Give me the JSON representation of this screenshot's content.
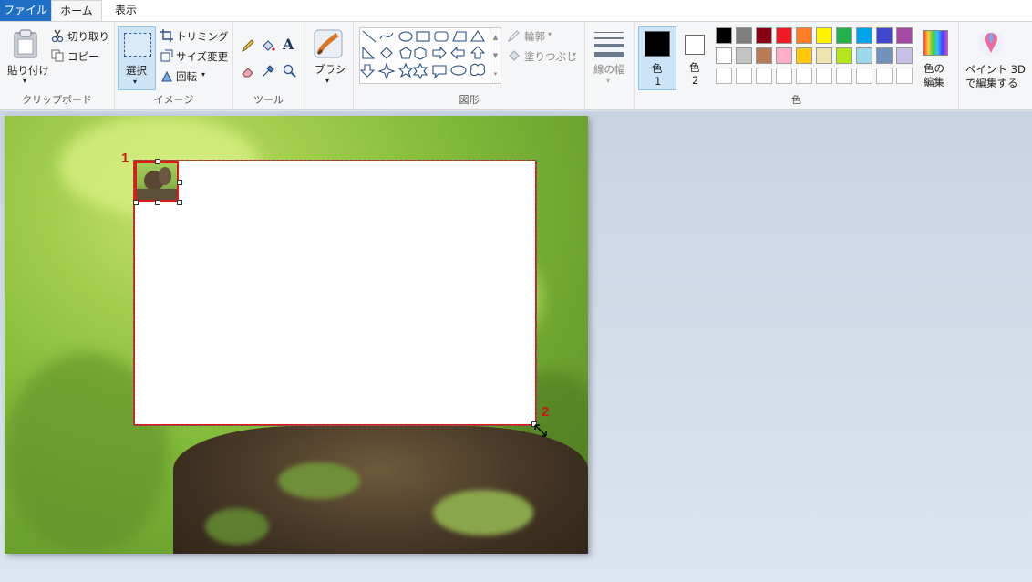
{
  "tabs": {
    "file": "ファイル",
    "home": "ホーム",
    "view": "表示"
  },
  "clipboard": {
    "paste": "貼り付け",
    "cut": "切り取り",
    "copy": "コピー",
    "label": "クリップボード"
  },
  "image": {
    "select": "選択",
    "crop": "トリミング",
    "resize": "サイズ変更",
    "rotate": "回転",
    "label": "イメージ"
  },
  "tools": {
    "label": "ツール"
  },
  "brushes": {
    "label": "ブラシ"
  },
  "shapes": {
    "outline": "輪郭",
    "fill": "塗りつぶし",
    "label": "図形"
  },
  "size": {
    "label": "線の幅"
  },
  "colors": {
    "color1": "色",
    "color1_num": "1",
    "color2": "色",
    "color2_num": "2",
    "edit_line1": "色の",
    "edit_line2": "編集",
    "label": "色",
    "color1_value": "#000000",
    "color2_value": "#ffffff",
    "palette_row1": [
      "#000000",
      "#7f7f7f",
      "#880015",
      "#ed1c24",
      "#ff7f27",
      "#fff200",
      "#22b14c",
      "#00a2e8",
      "#3f48cc",
      "#a349a4"
    ],
    "palette_row2": [
      "#ffffff",
      "#c3c3c3",
      "#b97a57",
      "#ffaec9",
      "#ffc90e",
      "#efe4b0",
      "#b5e61d",
      "#99d9ea",
      "#7092be",
      "#c8bfe7"
    ]
  },
  "paint3d": {
    "line1": "ペイント 3D",
    "line2": "で編集する"
  },
  "callouts": {
    "one": "1",
    "two": "2"
  }
}
